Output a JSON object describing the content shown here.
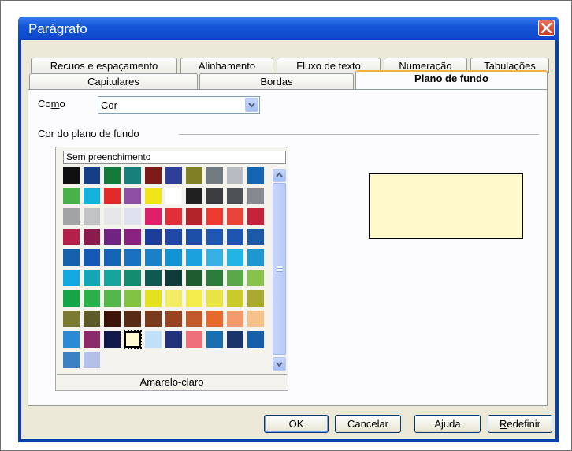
{
  "window": {
    "title": "Parágrafo"
  },
  "tabs": {
    "row1": [
      "Recuos e espaçamento",
      "Alinhamento",
      "Fluxo de texto",
      "Numeração",
      "Tabulações"
    ],
    "row2": [
      "Capitulares",
      "Bordas",
      "Plano de fundo"
    ],
    "active": "Plano de fundo"
  },
  "como": {
    "label": "Como",
    "value": "Cor"
  },
  "background_color_group": {
    "label": "Cor do plano de fundo"
  },
  "palette": {
    "no_fill": "Sem preenchimento",
    "selected_name": "Amarelo-claro",
    "selected_index": 83,
    "colors": [
      "#101010",
      "#143f86",
      "#127a3a",
      "#157f7a",
      "#7d1a1a",
      "#2d3f99",
      "#7f7f26",
      "#707a80",
      "#b7bcc2",
      "#1466b3",
      "#48b148",
      "#12b2dd",
      "#e32a2a",
      "#8e4fa5",
      "#f0e515",
      "#ffffff",
      "#202020",
      "#3b3c40",
      "#4e5156",
      "#858a90",
      "#a2a3a5",
      "#c1c3c6",
      "#e6e7e9",
      "#e0e1f0",
      "#e01e6a",
      "#e02f38",
      "#b3242a",
      "#ec3a30",
      "#e9443a",
      "#c3223a",
      "#b3204a",
      "#8c1b4d",
      "#6e2480",
      "#8a2080",
      "#1c3d9a",
      "#1e47a8",
      "#1d4fa9",
      "#1d57b3",
      "#1e55b1",
      "#1a5aa9",
      "#1561ab",
      "#1459b6",
      "#1364b4",
      "#1a70c0",
      "#1a81c8",
      "#1093d4",
      "#1ca1df",
      "#36b0e2",
      "#22b5e4",
      "#1c97cf",
      "#13a8df",
      "#15a6b6",
      "#16a39b",
      "#148b6f",
      "#0e5a52",
      "#0f3a3a",
      "#1f5d31",
      "#2c7d3b",
      "#5aa847",
      "#87c24a",
      "#15a546",
      "#2cae4a",
      "#52b648",
      "#80c241",
      "#e4e21f",
      "#f3ed64",
      "#f2ec4c",
      "#e9e540",
      "#cacb2a",
      "#aaa82e",
      "#7a7a32",
      "#5c5a26",
      "#3d140a",
      "#5a2a14",
      "#7a3a1c",
      "#9a4320",
      "#c15a2a",
      "#e8692b",
      "#f49a6a",
      "#f7c28a",
      "#2a8ad6",
      "#8c2b6a",
      "#121a4c",
      "#fffbcf",
      "#bfe0f6",
      "#23307a",
      "#ef707a",
      "#1a6fb0",
      "#1a346a",
      "#1560a8",
      "#3a80c2",
      "#b5c0e8"
    ]
  },
  "buttons": {
    "ok": "OK",
    "cancel": "Cancelar",
    "help": "Ajuda",
    "reset": "Redefinir"
  }
}
